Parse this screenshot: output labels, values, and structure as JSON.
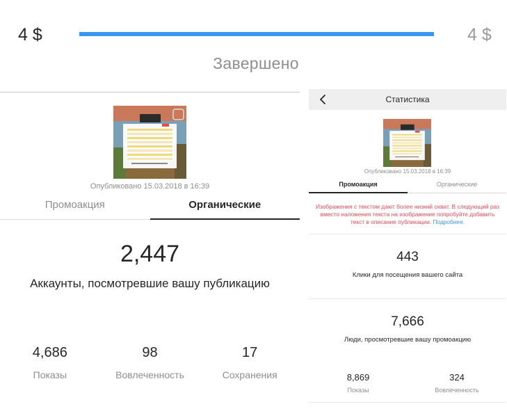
{
  "budget": {
    "spent": "4 $",
    "total": "4 $",
    "progress_fraction": 1.0,
    "status": "Завершено",
    "bar_color": "#3897f0"
  },
  "left_panel": {
    "published": "Опубликовано 15.03.2018 в 16:39",
    "tabs": [
      {
        "label": "Промоакция",
        "active": false
      },
      {
        "label": "Органические",
        "active": true
      }
    ],
    "reach_value": "2,447",
    "reach_label": "Аккаунты, посмотревшие вашу публикацию",
    "stats": [
      {
        "value": "4,686",
        "label": "Показы"
      },
      {
        "value": "98",
        "label": "Вовлеченность"
      },
      {
        "value": "17",
        "label": "Сохранения"
      }
    ]
  },
  "right_panel": {
    "title": "Статистика",
    "back_icon": "chevron-left-icon",
    "published": "Опубликовано 15.03.2018 в 16:39",
    "tabs": [
      {
        "label": "Промоакция",
        "active": true
      },
      {
        "label": "Органические",
        "active": false
      }
    ],
    "warning": "Изображения с текстом дают более низкий охват. В следующий раз вместо наложения текста на изображение попробуйте добавить текст в описание публикации.",
    "warning_link": "Подробнее.",
    "clicks_value": "443",
    "clicks_label": "Клики для посещения вашего сайта",
    "people_value": "7,666",
    "people_label": "Люди, просмотревшие вашу промоакцию",
    "stats": [
      {
        "value": "8,869",
        "label": "Показы"
      },
      {
        "value": "324",
        "label": "Вовлеченность"
      }
    ]
  },
  "colors": {
    "accent": "#3897f0",
    "warning": "#ed4956",
    "text": "#262626",
    "muted": "#8e8e8e"
  }
}
